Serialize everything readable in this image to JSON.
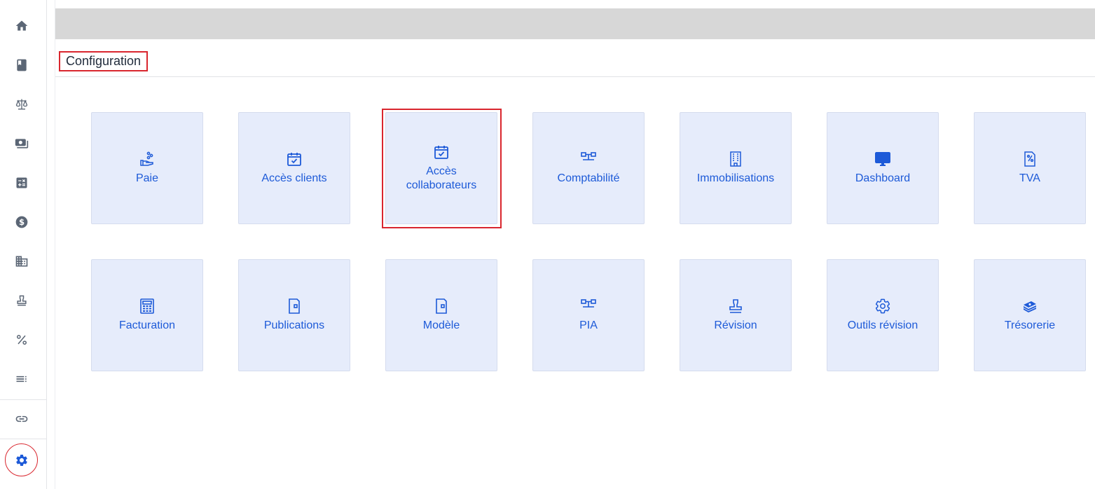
{
  "colors": {
    "accent": "#1d5ad8",
    "tile_bg": "#e6ecfb",
    "sidebar_icon": "#5b6675",
    "highlight": "#d9262e",
    "topbar": "#d7d7d7"
  },
  "sidebar": {
    "items": [
      {
        "icon": "home-icon"
      },
      {
        "icon": "book-icon"
      },
      {
        "icon": "balance-scale-icon"
      },
      {
        "icon": "money-icon"
      },
      {
        "icon": "calculator-icon"
      },
      {
        "icon": "dollar-icon"
      },
      {
        "icon": "building-icon"
      },
      {
        "icon": "stamp-icon"
      },
      {
        "icon": "percent-icon"
      },
      {
        "icon": "list-icon"
      },
      {
        "icon": "link-icon"
      },
      {
        "icon": "gear-icon",
        "active": true
      }
    ]
  },
  "page": {
    "title": "Configuration"
  },
  "tiles": [
    {
      "label": "Paie",
      "icon": "hand-coins-icon"
    },
    {
      "label": "Accès clients",
      "icon": "calendar-check-icon"
    },
    {
      "label": "Accès collaborateurs",
      "icon": "calendar-check-icon",
      "highlighted": true
    },
    {
      "label": "Comptabilité",
      "icon": "hierarchy-icon"
    },
    {
      "label": "Immobilisations",
      "icon": "building-icon"
    },
    {
      "label": "Dashboard",
      "icon": "monitor-icon"
    },
    {
      "label": "TVA",
      "icon": "percent-document-icon"
    },
    {
      "label": "Facturation",
      "icon": "calculator-icon"
    },
    {
      "label": "Publications",
      "icon": "folder-icon"
    },
    {
      "label": "Modèle",
      "icon": "folder-icon"
    },
    {
      "label": "PIA",
      "icon": "hierarchy-icon"
    },
    {
      "label": "Révision",
      "icon": "stamp-icon"
    },
    {
      "label": "Outils révision",
      "icon": "gear-icon"
    },
    {
      "label": "Trésorerie",
      "icon": "cash-stack-icon"
    }
  ]
}
